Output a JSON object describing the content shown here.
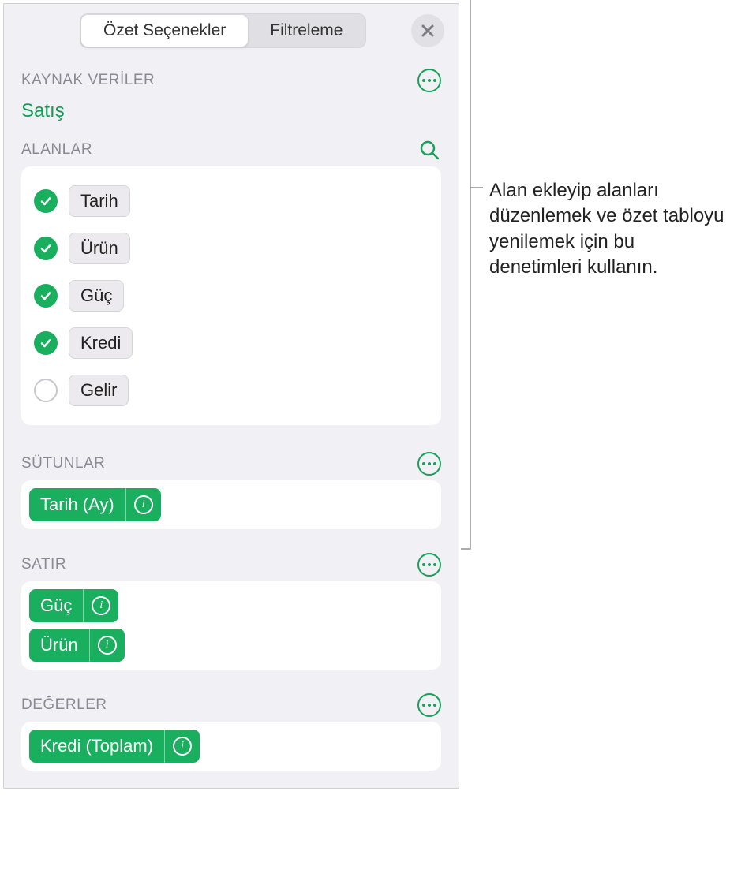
{
  "tabs": {
    "summary": "Özet Seçenekler",
    "filtering": "Filtreleme"
  },
  "source": {
    "section_label": "KAYNAK VERİLER",
    "source_name": "Satış"
  },
  "fields": {
    "section_label": "ALANLAR",
    "items": [
      {
        "label": "Tarih",
        "checked": true
      },
      {
        "label": "Ürün",
        "checked": true
      },
      {
        "label": "Güç",
        "checked": true
      },
      {
        "label": "Kredi",
        "checked": true
      },
      {
        "label": "Gelir",
        "checked": false
      }
    ]
  },
  "columns": {
    "section_label": "SÜTUNLAR",
    "items": [
      {
        "label": "Tarih (Ay)"
      }
    ]
  },
  "rows": {
    "section_label": "SATIR",
    "items": [
      {
        "label": "Güç"
      },
      {
        "label": "Ürün"
      }
    ]
  },
  "values": {
    "section_label": "DEĞERLER",
    "items": [
      {
        "label": "Kredi (Toplam)"
      }
    ]
  },
  "callout": {
    "text": "Alan ekleyip alanları düzenlemek ve özet tabloyu yenilemek için bu denetimleri kullanın."
  }
}
